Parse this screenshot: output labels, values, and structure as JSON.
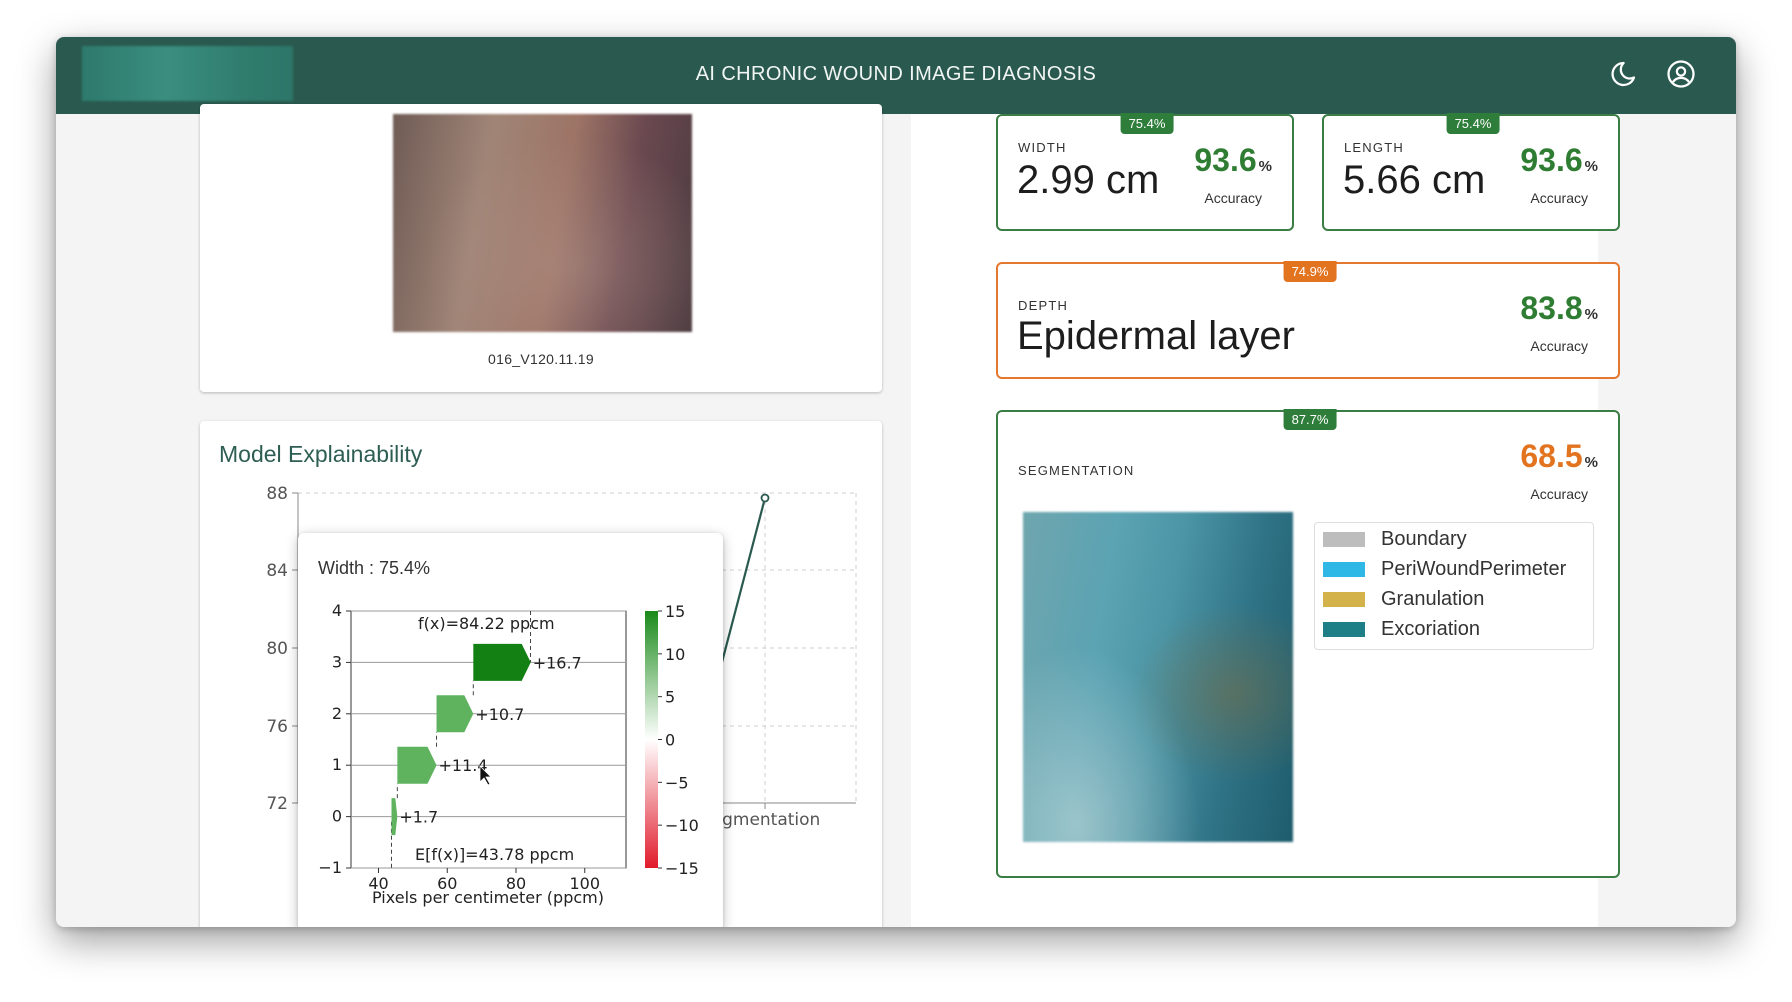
{
  "app": {
    "title": "AI CHRONIC WOUND IMAGE DIAGNOSIS"
  },
  "header_icons": [
    "moon-icon",
    "account-circle-icon"
  ],
  "image_card": {
    "caption": "016_V120.11.19"
  },
  "explainability": {
    "title": "Model Explainability",
    "background_chart": {
      "y_ticks": [
        "88",
        "84",
        "80",
        "76",
        "72"
      ],
      "x_label_fragment": "egmentation"
    },
    "tooltip": {
      "title": "Width : 75.4%",
      "fx_label": "f(x)=84.22 ppcm",
      "efx_label": "E[f(x)]=43.78 ppcm",
      "x_axis_label": "Pixels per centimeter (ppcm)"
    }
  },
  "metrics": {
    "width": {
      "label": "WIDTH",
      "value": "2.99 cm",
      "badge": "75.4%",
      "accuracy": "93.6",
      "pct": "%",
      "accuracy_label": "Accuracy"
    },
    "length": {
      "label": "LENGTH",
      "value": "5.66 cm",
      "badge": "75.4%",
      "accuracy": "93.6",
      "pct": "%",
      "accuracy_label": "Accuracy"
    },
    "depth": {
      "label": "DEPTH",
      "value": "Epidermal layer",
      "badge": "74.9%",
      "accuracy": "83.8",
      "pct": "%",
      "accuracy_label": "Accuracy"
    },
    "segmentation": {
      "label": "SEGMENTATION",
      "badge": "87.7%",
      "accuracy": "68.5",
      "pct": "%",
      "accuracy_label": "Accuracy"
    }
  },
  "segmentation_legend": [
    {
      "label": "Boundary",
      "color": "#bdbdbd"
    },
    {
      "label": "PeriWoundPerimeter",
      "color": "#2fb8e6"
    },
    {
      "label": "Granulation",
      "color": "#d4b24a"
    },
    {
      "label": "Excoriation",
      "color": "#1f7f86"
    }
  ],
  "chart_data": {
    "type": "bar",
    "orientation": "horizontal",
    "title": "",
    "xlabel": "Pixels per centimeter (ppcm)",
    "ylabel": "",
    "x_ticks": [
      "40",
      "60",
      "80",
      "100"
    ],
    "y_ticks": [
      "4",
      "3",
      "2",
      "1",
      "0",
      "−1"
    ],
    "xlim": [
      32,
      112
    ],
    "ylim": [
      -1,
      4
    ],
    "base_value": 43.78,
    "final_value": 84.22,
    "contributions": [
      {
        "row": 0,
        "value": 1.7,
        "label": "+1.7"
      },
      {
        "row": 1,
        "value": 11.4,
        "label": "+11.4"
      },
      {
        "row": 2,
        "value": 10.7,
        "label": "+10.7"
      },
      {
        "row": 3,
        "value": 16.7,
        "label": "+16.7"
      }
    ],
    "colorbar": {
      "min": -15,
      "max": 15,
      "ticks": [
        "15",
        "10",
        "5",
        "0",
        "−5",
        "−10",
        "−15"
      ]
    }
  }
}
